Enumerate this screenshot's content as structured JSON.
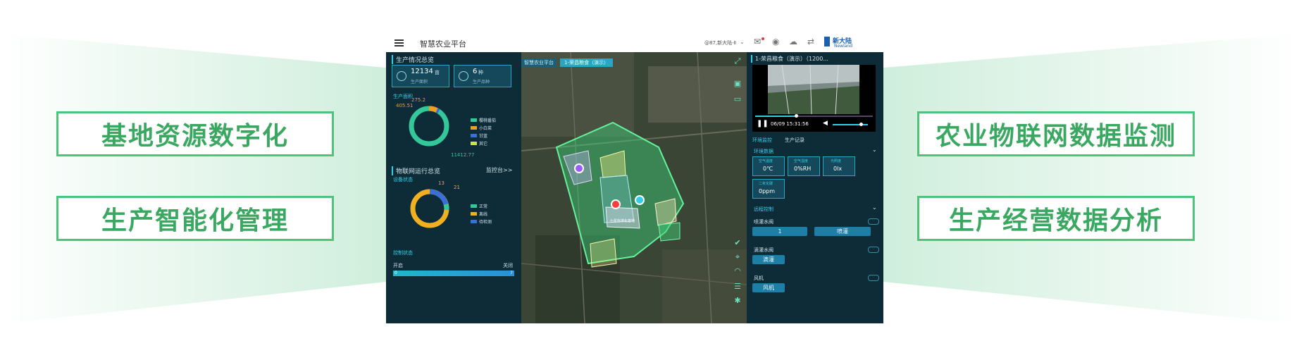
{
  "features": {
    "left_top": "基地资源数字化",
    "left_bottom": "生产智能化管理",
    "right_top": "农业物联网数据监测",
    "right_bottom": "生产经营数据分析"
  },
  "app": {
    "title": "智慧农业平台",
    "user": "@87,新大陆-Ⅱ",
    "brand": "新大陆",
    "brand_en": "Newland"
  },
  "left_panel": {
    "overview_title": "生产情况总览",
    "stat1_value": "12134",
    "stat1_unit": "亩",
    "stat1_label": "生产面积",
    "stat2_value": "6",
    "stat2_unit": "种",
    "stat2_label": "生产品种",
    "area_section": "生产面积",
    "donut1_value_a": "405.51",
    "donut1_value_b": "275.2",
    "donut1_value_c": "11412.77",
    "donut1_legend": [
      "樱桃番茄",
      "小白菜",
      "甘蓝",
      "其它"
    ],
    "iot_title": "物联网运行总览",
    "iot_link": "监控台>>",
    "device_section": "设备状态",
    "donut2_value_a": "13",
    "donut2_value_b": "21",
    "donut2_legend": [
      "正常",
      "离线",
      "待检测"
    ],
    "control_section": "控制状态",
    "open_label": "开启",
    "close_label": "关闭",
    "bar_left": "0",
    "bar_right": "7"
  },
  "map": {
    "breadcrumb": [
      "智慧农业平台",
      "1-荣昌粮食（演示）"
    ],
    "field_label": "七星标准化基地"
  },
  "right_panel": {
    "title": "1-荣昌粮食（演示）（1200...",
    "video_time": "06/09 15:31:56",
    "tabs": [
      "环境监控",
      "生产记录"
    ],
    "env_section": "环境数据",
    "sensors": [
      {
        "label": "空气温度",
        "value": "0℃"
      },
      {
        "label": "空气湿度",
        "value": "0%RH"
      },
      {
        "label": "光照度",
        "value": "0lx"
      },
      {
        "label": "二氧化碳",
        "value": "0ppm"
      }
    ],
    "remote_section": "远程控制",
    "controls": [
      {
        "name": "喷灌水阀",
        "buttons": [
          "1",
          "喷灌"
        ]
      },
      {
        "name": "滴灌水阀",
        "buttons": [
          "滴灌"
        ]
      },
      {
        "name": "风机",
        "buttons": [
          "风机"
        ]
      }
    ]
  },
  "colors": {
    "accent_green": "#3aa860",
    "panel_bg": "#0e2b38",
    "cyan": "#2fd0e6"
  }
}
